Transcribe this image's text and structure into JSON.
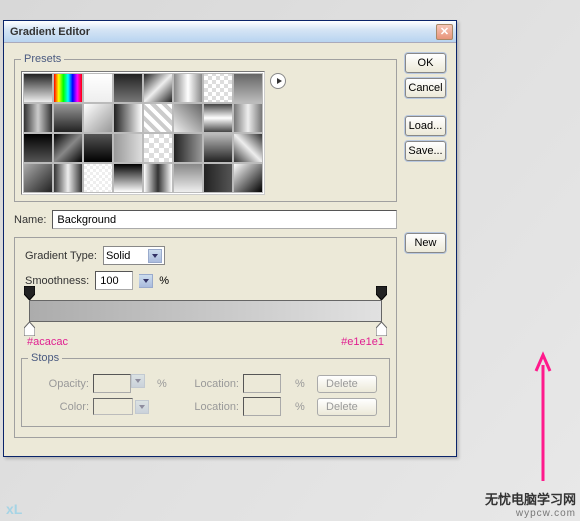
{
  "dialog": {
    "title": "Gradient Editor",
    "buttons": {
      "ok": "OK",
      "cancel": "Cancel",
      "load": "Load...",
      "save": "Save...",
      "new": "New"
    },
    "presets_legend": "Presets",
    "name_label": "Name:",
    "name_value": "Background",
    "gradient_type_label": "Gradient Type:",
    "gradient_type_value": "Solid",
    "smoothness_label": "Smoothness:",
    "smoothness_value": "100",
    "percent": "%",
    "hex_left": "#acacac",
    "hex_right": "#e1e1e1",
    "stops_legend": "Stops",
    "opacity_label": "Opacity:",
    "color_label": "Color:",
    "location_label": "Location:",
    "delete_label": "Delete"
  },
  "swatches": [
    "linear-gradient(#222,#eee)",
    "linear-gradient(90deg,red,yellow,lime,cyan,blue,magenta,red)",
    "linear-gradient(#fff,#eee)",
    "linear-gradient(#222,#777)",
    "linear-gradient(135deg,#222,#eee,#222)",
    "linear-gradient(90deg,#888,#fff,#888)",
    "repeating-conic-gradient(#ddd 0 25%,#fff 0 50%) 0/8px 8px",
    "linear-gradient(#666,#bbb)",
    "linear-gradient(90deg,#333,#ccc,#333)",
    "linear-gradient(#999,#222)",
    "linear-gradient(135deg,#fff,#999)",
    "linear-gradient(90deg,#222,#fff)",
    "repeating-linear-gradient(45deg,#ccc 0 4px,#fff 4px 8px)",
    "linear-gradient(45deg,#eee,#666)",
    "linear-gradient(#444,#fff,#444)",
    "linear-gradient(90deg,#777,#eee,#777)",
    "linear-gradient(#000,#555)",
    "linear-gradient(135deg,#000,#888,#000)",
    "linear-gradient(#555,#000)",
    "linear-gradient(90deg,#999,#ddd)",
    "repeating-conic-gradient(#ddd 0 25%,#fff 0 50%) 0/10px 10px",
    "linear-gradient(90deg,#222,#999)",
    "linear-gradient(#bbb,#222)",
    "linear-gradient(45deg,#333,#eee,#333)",
    "linear-gradient(135deg,#aaa,#222)",
    "linear-gradient(90deg,#333,#eee,#333)",
    "repeating-conic-gradient(#eee 0 25%,#fff 0 50%) 0/6px 6px",
    "linear-gradient(#000,#fff)",
    "linear-gradient(90deg,#fff,#333,#fff)",
    "linear-gradient(#888,#eee)",
    "linear-gradient(90deg,#222,#555)",
    "linear-gradient(135deg,#fff,#000)"
  ],
  "watermark": {
    "line1": "无忧电脑学习网",
    "line2": "wypcw.com"
  },
  "xu": "xL"
}
